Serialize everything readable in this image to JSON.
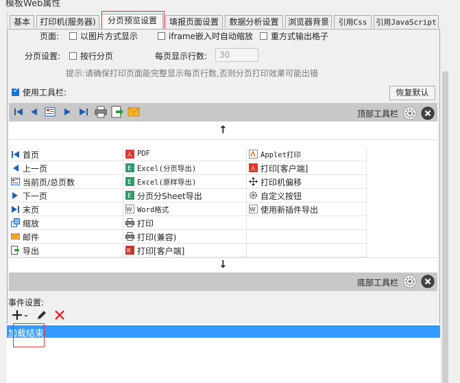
{
  "window": {
    "title": "模板Web属性"
  },
  "tabs": [
    {
      "label": "基本"
    },
    {
      "label": "打印机(服务器)"
    },
    {
      "label": "分页预览设置"
    },
    {
      "label": "填报页面设置"
    },
    {
      "label": "数据分析设置"
    },
    {
      "label": "浏览器背景"
    },
    {
      "label": "引用Css"
    },
    {
      "label": "引用JavaScript"
    }
  ],
  "page_settings": {
    "page_label": "页面:",
    "opt_image_mode": "以图片方式显示",
    "opt_iframe_zoom": "iframe嵌入时自动缩放",
    "opt_redraw_grid": "重方式输出格子",
    "paging_label": "分页设置:",
    "opt_by_row": "按行分页",
    "rows_per_page_label": "每页显示行数:",
    "rows_per_page_value": "30",
    "hint": "提示:请确保打印页面能完整显示每页行数,否则分页打印效果可能出错"
  },
  "toolbar_settings": {
    "use_toolbar_label": "使用工具栏:",
    "use_toolbar_checked": true,
    "restore_default": "恢复默认",
    "top_toolbar_label": "顶部工具栏",
    "bottom_toolbar_label": "底部工具栏",
    "up_arrow": "↑",
    "down_arrow": "↓"
  },
  "available_buttons": {
    "col1": [
      {
        "label": "首页",
        "icon": "first-page-icon"
      },
      {
        "label": "上一页",
        "icon": "prev-page-icon"
      },
      {
        "label": "当前页/总页数",
        "icon": "page-count-icon"
      },
      {
        "label": "下一页",
        "icon": "next-page-icon"
      },
      {
        "label": "末页",
        "icon": "last-page-icon"
      },
      {
        "label": "缩放",
        "icon": "zoom-icon"
      },
      {
        "label": "邮件",
        "icon": "mail-icon"
      },
      {
        "label": "导出",
        "icon": "export-icon"
      }
    ],
    "col2": [
      {
        "label": "PDF",
        "icon": "pdf-icon"
      },
      {
        "label": "Excel(分页导出)",
        "icon": "excel-icon"
      },
      {
        "label": "Excel(原样导出)",
        "icon": "excel-icon"
      },
      {
        "label": "分页分Sheet导出",
        "icon": "excel-icon"
      },
      {
        "label": "Word格式",
        "icon": "word-icon"
      },
      {
        "label": "打印",
        "icon": "printer-icon"
      },
      {
        "label": "打印(兼容)",
        "icon": "printer-icon"
      },
      {
        "label": "打印[客户端]",
        "icon": "client-print-icon"
      }
    ],
    "col3": [
      {
        "label": "Applet打印",
        "icon": "applet-icon"
      },
      {
        "label": "打印[客户端]",
        "icon": "pdf-print-icon"
      },
      {
        "label": "打印机偏移",
        "icon": "move-icon"
      },
      {
        "label": "自定义按钮",
        "icon": "gear-icon"
      },
      {
        "label": "使用新插件导出",
        "icon": "word-icon"
      }
    ]
  },
  "events": {
    "label": "事件设置:",
    "items": [
      {
        "label": "加载结束"
      }
    ]
  },
  "colors": {
    "accent": "#1a73d9",
    "highlight_red": "#e8262a",
    "selected_row": "#3399ff"
  }
}
